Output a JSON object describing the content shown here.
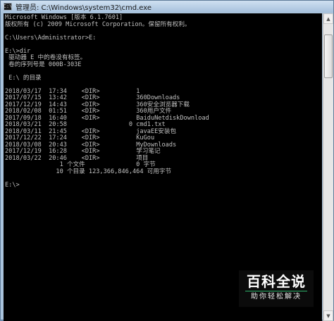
{
  "window": {
    "title": "管理员: C:\\Windows\\system32\\cmd.exe",
    "icon_text": "C:\\"
  },
  "console": {
    "lines": [
      "Microsoft Windows [版本 6.1.7601]",
      "版权所有 (c) 2009 Microsoft Corporation。保留所有权利。",
      "",
      "C:\\Users\\Administrator>E:",
      "",
      "E:\\>dir",
      " 驱动器 E 中的卷没有标签。",
      " 卷的序列号是 000B-303E",
      "",
      " E:\\ 的目录",
      "",
      "2018/03/17  17:34    <DIR>          1",
      "2017/07/15  13:42    <DIR>          360Downloads",
      "2017/12/19  14:43    <DIR>          360安全浏览器下载",
      "2018/02/08  01:51    <DIR>          360用户文件",
      "2017/09/18  16:40    <DIR>          BaiduNetdiskDownload",
      "2018/03/21  20:58                 0 cmd1.txt",
      "2018/03/11  21:45    <DIR>          javaEE安装包",
      "2017/12/22  17:24    <DIR>          KuGou",
      "2018/03/08  20:43    <DIR>          MyDownloads",
      "2017/12/19  16:28    <DIR>          学习笔记",
      "2018/03/22  20:46    <DIR>          项目",
      "               1 个文件              0 字节",
      "              10 个目录 123,366,846,464 可用字节",
      "",
      "E:\\>"
    ]
  },
  "scrollbar": {
    "up_icon": "scroll-up-arrow-icon",
    "down_icon": "scroll-down-arrow-icon",
    "up_glyph": "▲",
    "down_glyph": "▼"
  },
  "watermark": {
    "main": "百科全说",
    "sub": "助你轻松解决",
    "accent": "#2fb36b"
  }
}
